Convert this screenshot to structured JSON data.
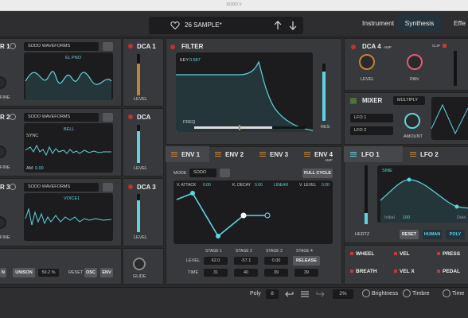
{
  "title_bar": {
    "title": "SODO V"
  },
  "header": {
    "preset_name": "26 SAMPLE*",
    "tabs": [
      "Instrument",
      "Synthesis",
      "Effe"
    ],
    "selected_tab": "Synthesis"
  },
  "osc1": {
    "title": "R 1",
    "waveform": "SODO WAVEFORMS",
    "wave_name": "EL PNO",
    "fine": "FINE"
  },
  "osc2": {
    "title": "R 2",
    "waveform": "SODO WAVEFORMS",
    "wave_name": "BELL",
    "sync": "SYNC",
    "am": "AM",
    "am_value": "0.00",
    "fine": "FINE"
  },
  "osc3": {
    "title": "R 3",
    "waveform": "SODO WAVEFORMS",
    "wave_name": "VOICE1",
    "fine": "FINE"
  },
  "osc_footer": {
    "unison_left": "N",
    "unison": "UNISON",
    "unison_value": "59.2 %",
    "reset": "RESET",
    "osc": "OSC",
    "env": "ENV"
  },
  "dca1": {
    "title": "DCA 1",
    "level": "LEVEL"
  },
  "dca2": {
    "title": "DCA",
    "level": "LEVEL"
  },
  "dca3": {
    "title": "DCA 3",
    "level": "LEVEL"
  },
  "glide": {
    "label": "GLIDE"
  },
  "filter": {
    "title": "FILTER",
    "key_label": "KEY",
    "key_value": "0.587",
    "freq": "FREQ",
    "res": "RES"
  },
  "env": {
    "tabs": [
      "ENV 1",
      "ENV 2",
      "ENV 3",
      "ENV 4"
    ],
    "env4_sub": "AMP",
    "mode_label": "MODE",
    "mode_value": "SODO",
    "full_cycle": "FULL CYCLE",
    "params": {
      "v_attack_label": "V. ATTACK",
      "v_attack": "0.00",
      "k_decay_label": "K. DECAY",
      "k_decay": "0.00",
      "curve": "LINEAR",
      "v_level_label": "V. LEVEL",
      "v_level": "0.00"
    },
    "stage_headers": [
      "STAGE 1",
      "STAGE 2",
      "STAGE 3",
      "STAGE 4"
    ],
    "level_label": "LEVEL",
    "time_label": "TIME",
    "level_values": [
      "62.0",
      "-57.1",
      "0.00",
      "RELEASE"
    ],
    "time_values": [
      "31",
      "40",
      "39",
      "39"
    ]
  },
  "dca4": {
    "title": "DCA 4",
    "amp": "AMP",
    "clip": "CLIP",
    "level": "LEVEL",
    "pan": "PAN"
  },
  "mixer": {
    "title": "MIXER",
    "mode": "MULTIPLY",
    "input1": "LFO 1",
    "input2": "LFO 2",
    "amount": "AMOUNT"
  },
  "lfo": {
    "tabs": [
      "LFO 1",
      "LFO 2"
    ],
    "shape": "SINE",
    "initial_label": "Initial",
    "initial_value": "100",
    "delay_label": "Dela",
    "rate_unit": "HERTZ",
    "reset": "RESET",
    "human": "HUMAN",
    "poly": "POLY"
  },
  "mods": {
    "items": [
      "WHEEL",
      "VEL",
      "PRESS",
      "BREATH",
      "VEL X",
      "PEDAL"
    ]
  },
  "bottom": {
    "poly_label": "Poly",
    "poly_value": "8",
    "percent": "2%",
    "brightness": "Brightness",
    "timbre": "Timbre",
    "time": "Time"
  },
  "colors": {
    "accent": "#5fd3e0",
    "active_tab": "#23323b",
    "orange": "#c58430",
    "red": "#c23a3a"
  }
}
